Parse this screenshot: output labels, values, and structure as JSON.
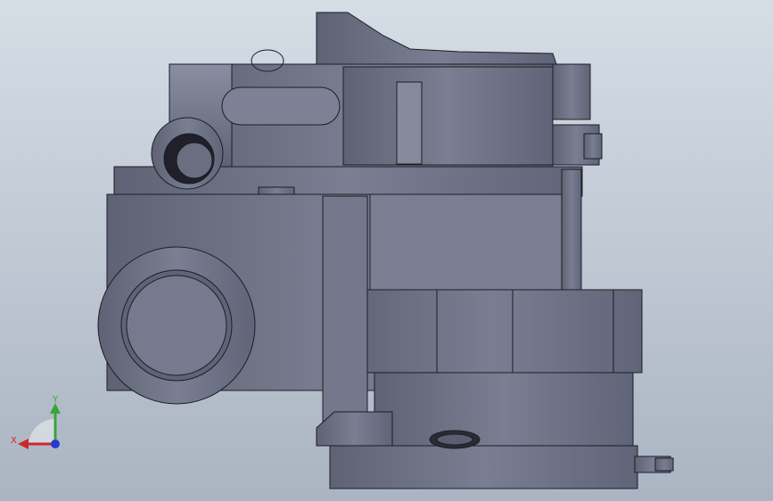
{
  "viewport": {
    "background_top": "#d5dde5",
    "background_bottom": "#aab4c2"
  },
  "model": {
    "body_color": "#6b6f82",
    "edge_color": "#1c1d24"
  },
  "triad": {
    "x_label": "X",
    "y_label": "Y",
    "x_color": "#cc2a2a",
    "y_color": "#3aa43a",
    "z_color": "#2a3ad0"
  }
}
